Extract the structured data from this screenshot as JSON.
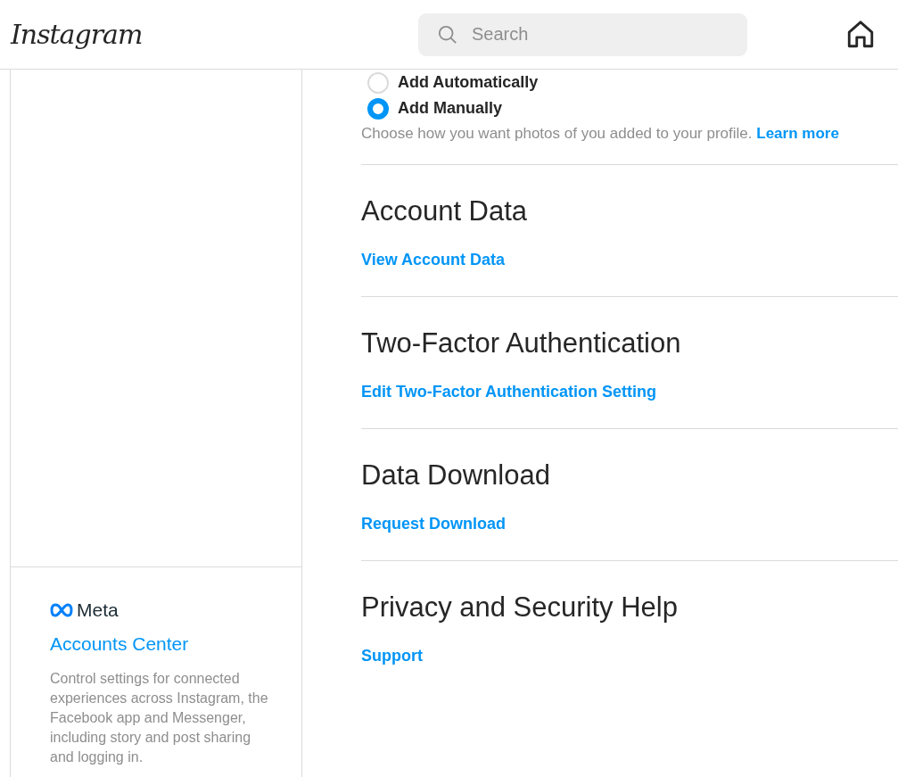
{
  "header": {
    "logo": "Instagram",
    "search": {
      "placeholder": "Search"
    }
  },
  "photo_options": [
    {
      "label": "Add Automatically",
      "selected": false
    },
    {
      "label": "Add Manually",
      "selected": true
    }
  ],
  "photo_caption": {
    "text": "Choose how you want photos of you added to your profile.",
    "link": "Learn more"
  },
  "sections": [
    {
      "title": "Account Data",
      "link": "View Account Data"
    },
    {
      "title": "Two-Factor Authentication",
      "link": "Edit Two-Factor Authentication Setting"
    },
    {
      "title": "Data Download",
      "link": "Request Download"
    },
    {
      "title": "Privacy and Security Help",
      "link": "Support"
    }
  ],
  "accounts_center": {
    "brand": "Meta",
    "title": "Accounts Center",
    "description": "Control settings for connected experiences across Instagram, the Facebook app and Messenger, including story and post sharing and logging in."
  }
}
